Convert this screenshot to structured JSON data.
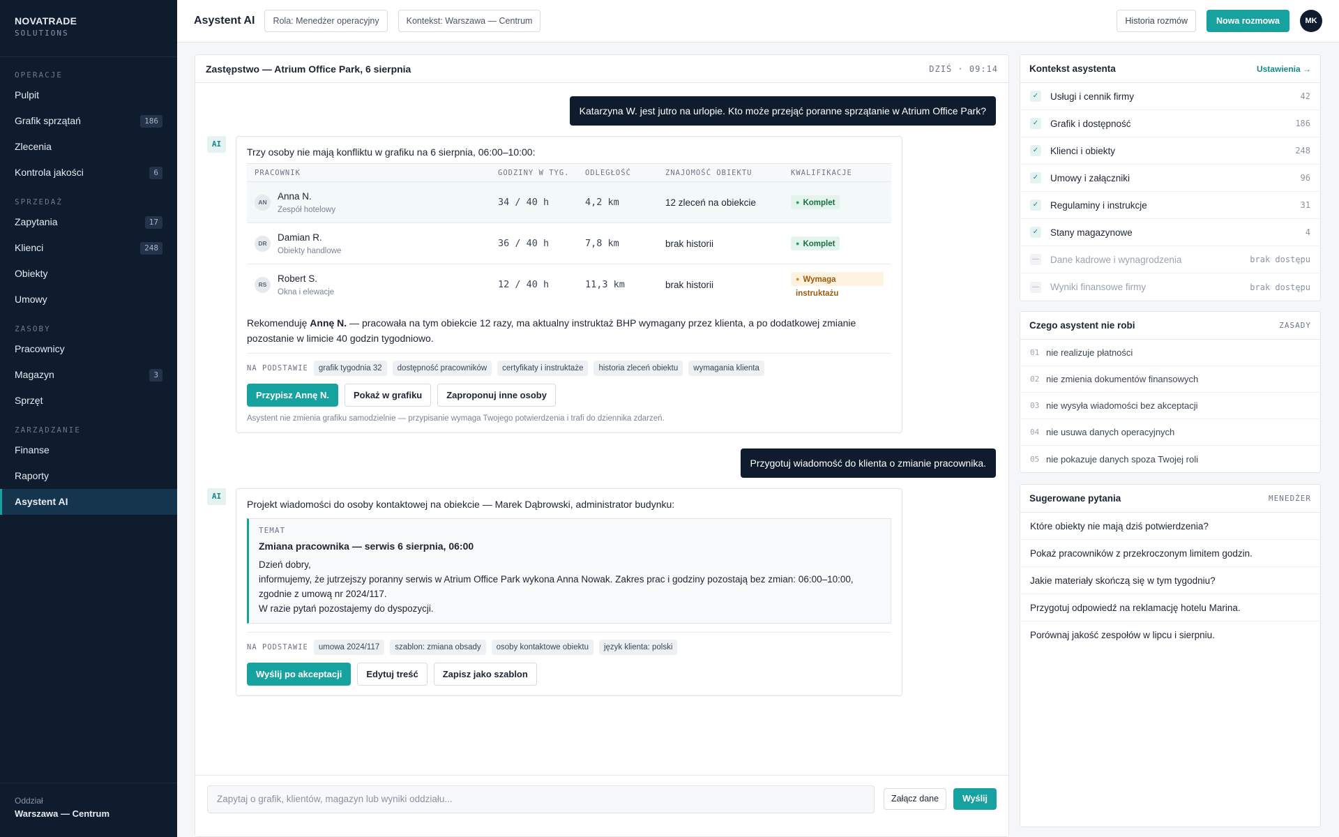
{
  "brand": {
    "name": "NOVATRADE",
    "sub": "SOLUTIONS"
  },
  "sidebar": {
    "sections": [
      {
        "title": "OPERACJE",
        "items": [
          {
            "label": "Pulpit",
            "badge": ""
          },
          {
            "label": "Grafik sprzątań",
            "badge": "186"
          },
          {
            "label": "Zlecenia",
            "badge": ""
          },
          {
            "label": "Kontrola jakości",
            "badge": "6"
          }
        ]
      },
      {
        "title": "SPRZEDAŻ",
        "items": [
          {
            "label": "Zapytania",
            "badge": "17"
          },
          {
            "label": "Klienci",
            "badge": "248"
          },
          {
            "label": "Obiekty",
            "badge": ""
          },
          {
            "label": "Umowy",
            "badge": ""
          }
        ]
      },
      {
        "title": "ZASOBY",
        "items": [
          {
            "label": "Pracownicy",
            "badge": ""
          },
          {
            "label": "Magazyn",
            "badge": "3"
          },
          {
            "label": "Sprzęt",
            "badge": ""
          }
        ]
      },
      {
        "title": "ZARZĄDZANIE",
        "items": [
          {
            "label": "Finanse",
            "badge": ""
          },
          {
            "label": "Raporty",
            "badge": ""
          },
          {
            "label": "Asystent AI",
            "badge": "",
            "active": true
          }
        ]
      }
    ],
    "branch_label": "Oddział",
    "branch_name": "Warszawa — Centrum"
  },
  "topbar": {
    "title": "Asystent AI",
    "role": "Rola: Menedżer operacyjny",
    "context": "Kontekst: Warszawa — Centrum",
    "history": "Historia rozmów",
    "new_chat": "Nowa rozmowa",
    "avatar": "MK"
  },
  "chat": {
    "title": "Zastępstwo — Atrium Office Park, 6 sierpnia",
    "time": "DZIŚ · 09:14",
    "user1": "Katarzyna W. jest jutro na urlopie. Kto może przejąć poranne sprzątanie w Atrium Office Park?",
    "ai_tag": "AI",
    "ai1": {
      "intro": "Trzy osoby nie mają konfliktu w grafiku na 6 sierpnia, 06:00–10:00:",
      "columns": [
        "PRACOWNIK",
        "GODZINY W TYG.",
        "ODLEGŁOŚĆ",
        "ZNAJOMOŚĆ OBIEKTU",
        "KWALIFIKACJE"
      ],
      "rows": [
        {
          "initials": "AN",
          "name": "Anna N.",
          "team": "Zespół hotelowy",
          "hours": "34 / 40 h",
          "distance": "4,2 km",
          "familiarity": "12 zleceń na obiekcie",
          "qual": "Komplet",
          "status": "ok"
        },
        {
          "initials": "DR",
          "name": "Damian R.",
          "team": "Obiekty handlowe",
          "hours": "36 / 40 h",
          "distance": "7,8 km",
          "familiarity": "brak historii",
          "qual": "Komplet",
          "status": "ok"
        },
        {
          "initials": "RS",
          "name": "Robert S.",
          "team": "Okna i elewacje",
          "hours": "12 / 40 h",
          "distance": "11,3 km",
          "familiarity": "brak historii",
          "qual": "Wymaga instruktażu",
          "status": "warn"
        }
      ],
      "reco_pre": "Rekomenduję ",
      "reco_bold": "Annę N.",
      "reco_post": " — pracowała na tym obiekcie 12 razy, ma aktualny instruktaż BHP wymagany przez klienta, a po dodatkowej zmianie pozostanie w limicie 40 godzin tygodniowo.",
      "basis_label": "NA PODSTAWIE",
      "basis": [
        "grafik tygodnia 32",
        "dostępność pracowników",
        "certyfikaty i instruktaże",
        "historia zleceń obiektu",
        "wymagania klienta"
      ],
      "actions": [
        "Przypisz Annę N.",
        "Pokaż w grafiku",
        "Zaproponuj inne osoby"
      ],
      "note": "Asystent nie zmienia grafiku samodzielnie — przypisanie wymaga Twojego potwierdzenia i trafi do dziennika zdarzeń."
    },
    "user2": "Przygotuj wiadomość do klienta o zmianie pracownika.",
    "ai2": {
      "intro": "Projekt wiadomości do osoby kontaktowej na obiekcie — Marek Dąbrowski, administrator budynku:",
      "draft_label": "TEMAT",
      "draft_subject": "Zmiana pracownika — serwis 6 sierpnia, 06:00",
      "draft_line1": "Dzień dobry,",
      "draft_line2": "informujemy, że jutrzejszy poranny serwis w Atrium Office Park wykona Anna Nowak. Zakres prac i godziny pozostają bez zmian: 06:00–10:00, zgodnie z umową nr 2024/117.",
      "draft_line3": "W razie pytań pozostajemy do dyspozycji.",
      "basis_label": "NA PODSTAWIE",
      "basis": [
        "umowa 2024/117",
        "szablon: zmiana obsady",
        "osoby kontaktowe obiektu",
        "język klienta: polski"
      ],
      "actions": [
        "Wyślij po akceptacji",
        "Edytuj treść",
        "Zapisz jako szablon"
      ]
    },
    "composer_placeholder": "Zapytaj o grafik, klientów, magazyn lub wyniki oddziału...",
    "attach": "Załącz dane",
    "send": "Wyślij"
  },
  "context_panel": {
    "title": "Kontekst asystenta",
    "link": "Ustawienia →",
    "items": [
      {
        "label": "Usługi i cennik firmy",
        "count": "42",
        "enabled": true
      },
      {
        "label": "Grafik i dostępność",
        "count": "186",
        "enabled": true
      },
      {
        "label": "Klienci i obiekty",
        "count": "248",
        "enabled": true
      },
      {
        "label": "Umowy i załączniki",
        "count": "96",
        "enabled": true
      },
      {
        "label": "Regulaminy i instrukcje",
        "count": "31",
        "enabled": true
      },
      {
        "label": "Stany magazynowe",
        "count": "4",
        "enabled": true
      },
      {
        "label": "Dane kadrowe i wynagrodzenia",
        "count": "brak dostępu",
        "enabled": false
      },
      {
        "label": "Wyniki finansowe firmy",
        "count": "brak dostępu",
        "enabled": false
      }
    ]
  },
  "rules_panel": {
    "title": "Czego asystent nie robi",
    "tag": "ZASADY",
    "items": [
      {
        "num": "01",
        "text": "nie realizuje płatności"
      },
      {
        "num": "02",
        "text": "nie zmienia dokumentów finansowych"
      },
      {
        "num": "03",
        "text": "nie wysyła wiadomości bez akceptacji"
      },
      {
        "num": "04",
        "text": "nie usuwa danych operacyjnych"
      },
      {
        "num": "05",
        "text": "nie pokazuje danych spoza Twojej roli"
      }
    ]
  },
  "questions_panel": {
    "title": "Sugerowane pytania",
    "tag": "MENEDŻER",
    "items": [
      "Które obiekty nie mają dziś potwierdzenia?",
      "Pokaż pracowników z przekroczonym limitem godzin.",
      "Jakie materiały skończą się w tym tygodniu?",
      "Przygotuj odpowiedź na reklamację hotelu Marina.",
      "Porównaj jakość zespołów w lipcu i sierpniu."
    ]
  },
  "colors": {
    "sidebar": "#0f1c2e",
    "accent": "#17a2a0",
    "ok": "#22a162",
    "warn": "#e08a1e"
  }
}
